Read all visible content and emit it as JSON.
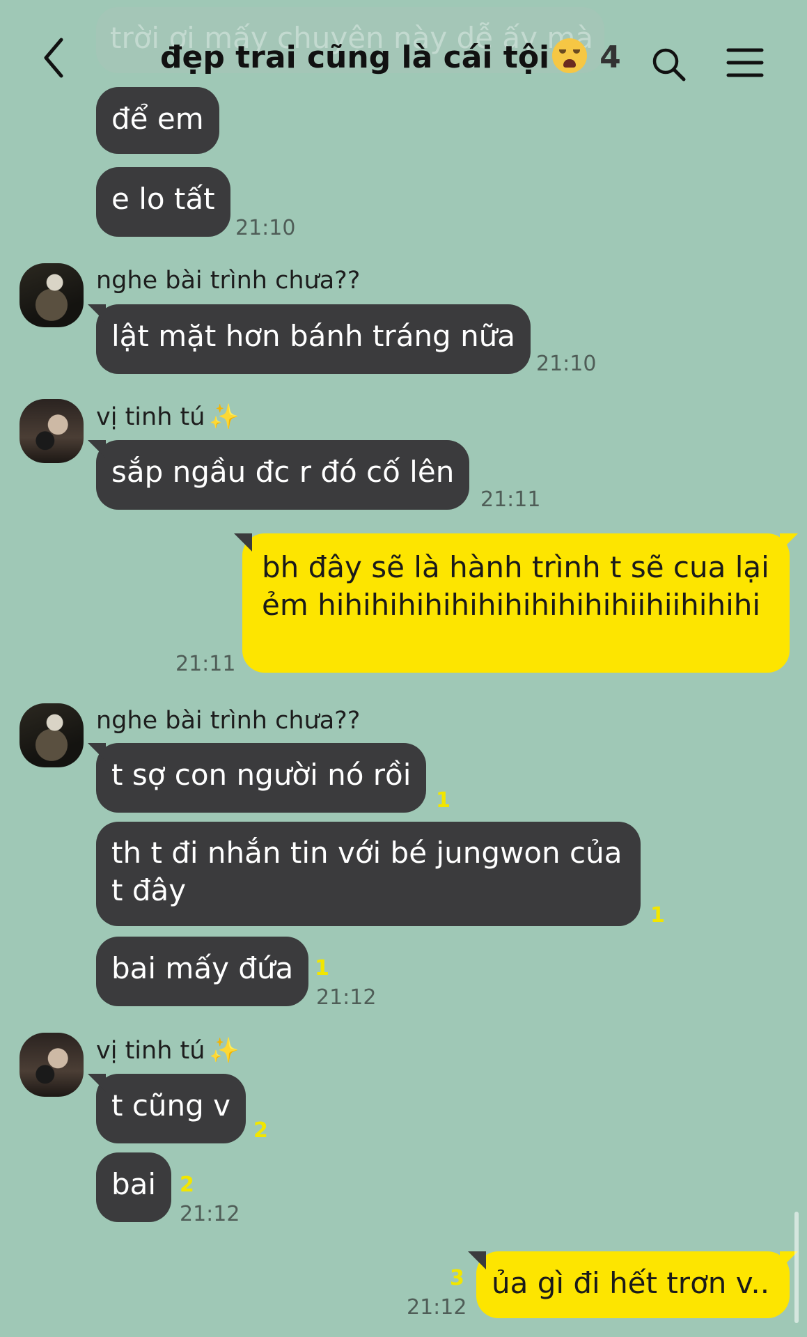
{
  "header": {
    "title": "đẹp trai cũng là cái tội",
    "member_count": "4"
  },
  "messages": {
    "faded_preview": "trời ơi mấy chuyện này dễ ấy mà",
    "m1": "để em",
    "m2": "e lo tất",
    "m2_time": "21:10",
    "sender_a": "nghe bài trình chưa??",
    "m3": "lật mặt hơn bánh tráng nữa",
    "m3_time": "21:10",
    "sender_b": "vị tinh tú",
    "sender_b_sparkle": "✨",
    "m4": "sắp ngầu đc r đó cố lên",
    "m4_time": "21:11",
    "m5": "bh đây sẽ là hành trình t sẽ cua lại ẻm hihihihihihihihihihihihiihiihihihi",
    "m5_time": "21:11",
    "sender_a2": "nghe bài trình chưa??",
    "m6": "t sợ con người nó rồi",
    "m6_unread": "1",
    "m7": "th t đi nhắn tin với bé jungwon của t đây",
    "m7_unread": "1",
    "m8": "bai mấy đứa",
    "m8_unread": "1",
    "m8_time": "21:12",
    "sender_b2": "vị tinh tú",
    "sender_b2_sparkle": "✨",
    "m9": "t cũng v",
    "m9_unread": "2",
    "m10": "bai",
    "m10_unread": "2",
    "m10_time": "21:12",
    "m11": "ủa gì đi hết trơn v..",
    "m11_unread": "3",
    "m11_time": "21:12"
  },
  "icons": {
    "back": "chevron-left-icon",
    "search": "search-icon",
    "menu": "menu-icon",
    "title_emoji": "crying-face-emoji"
  },
  "colors": {
    "background": "#9fc8b6",
    "bubble_other": "#3b3b3d",
    "bubble_me": "#fde500",
    "unread": "#f2e600"
  }
}
